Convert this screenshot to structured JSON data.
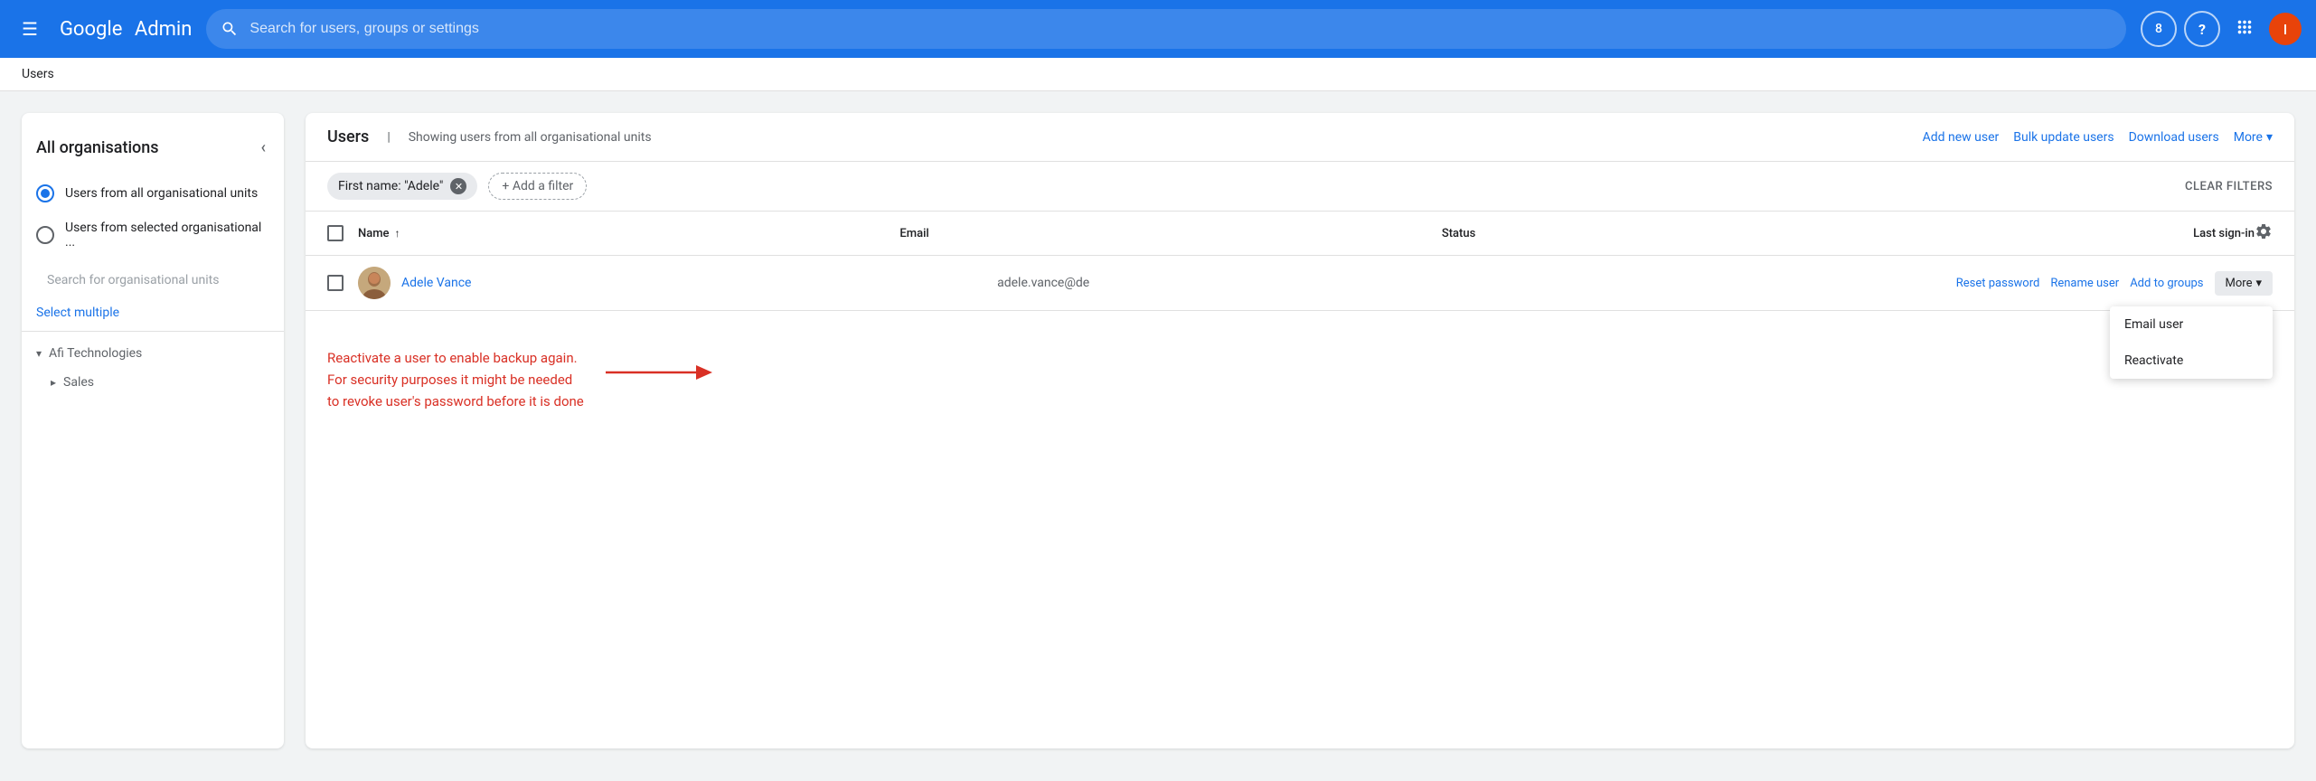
{
  "header": {
    "menu_icon": "☰",
    "logo_google": "Google",
    "logo_admin": "Admin",
    "search_placeholder": "Search for users, groups or settings",
    "support_label": "8",
    "help_label": "?",
    "avatar_label": "I"
  },
  "breadcrumb": {
    "label": "Users"
  },
  "sidebar": {
    "title": "All organisations",
    "collapse_icon": "‹",
    "options": [
      {
        "id": "all-org-units",
        "label": "Users from all organisational units",
        "selected": true
      },
      {
        "id": "selected-org-units",
        "label": "Users from selected organisational ...",
        "selected": false
      }
    ],
    "search_placeholder": "Search for organisational units",
    "select_multiple": "Select multiple",
    "org_items": [
      {
        "label": "Afi Technologies",
        "expanded": true,
        "level": 0
      },
      {
        "label": "Sales",
        "expanded": false,
        "level": 1
      }
    ]
  },
  "content": {
    "title": "Users",
    "separator": "|",
    "subtitle": "Showing users from all organisational units",
    "actions": {
      "add_new_user": "Add new user",
      "bulk_update_users": "Bulk update users",
      "download_users": "Download users",
      "more": "More"
    },
    "filters": {
      "active_filter_label": "First name: \"Adele\"",
      "add_filter_label": "+ Add a filter",
      "clear_filters_label": "CLEAR FILTERS"
    },
    "table": {
      "columns": [
        "Name",
        "Email",
        "Status",
        "Last sign-in"
      ],
      "sort_col": "Name",
      "rows": [
        {
          "name": "Adele Vance",
          "email": "adele.vance@de",
          "status": "",
          "last_signin": "",
          "actions": {
            "reset_password": "Reset password",
            "rename_user": "Rename user",
            "add_to_groups": "Add to groups",
            "more": "More"
          }
        }
      ]
    },
    "dropdown": {
      "items": [
        "Email user",
        "Reactivate"
      ]
    },
    "info_message": "Reactivate a user to enable backup again.\nFor security purposes it might be needed\nto revoke user's password before it is done"
  }
}
